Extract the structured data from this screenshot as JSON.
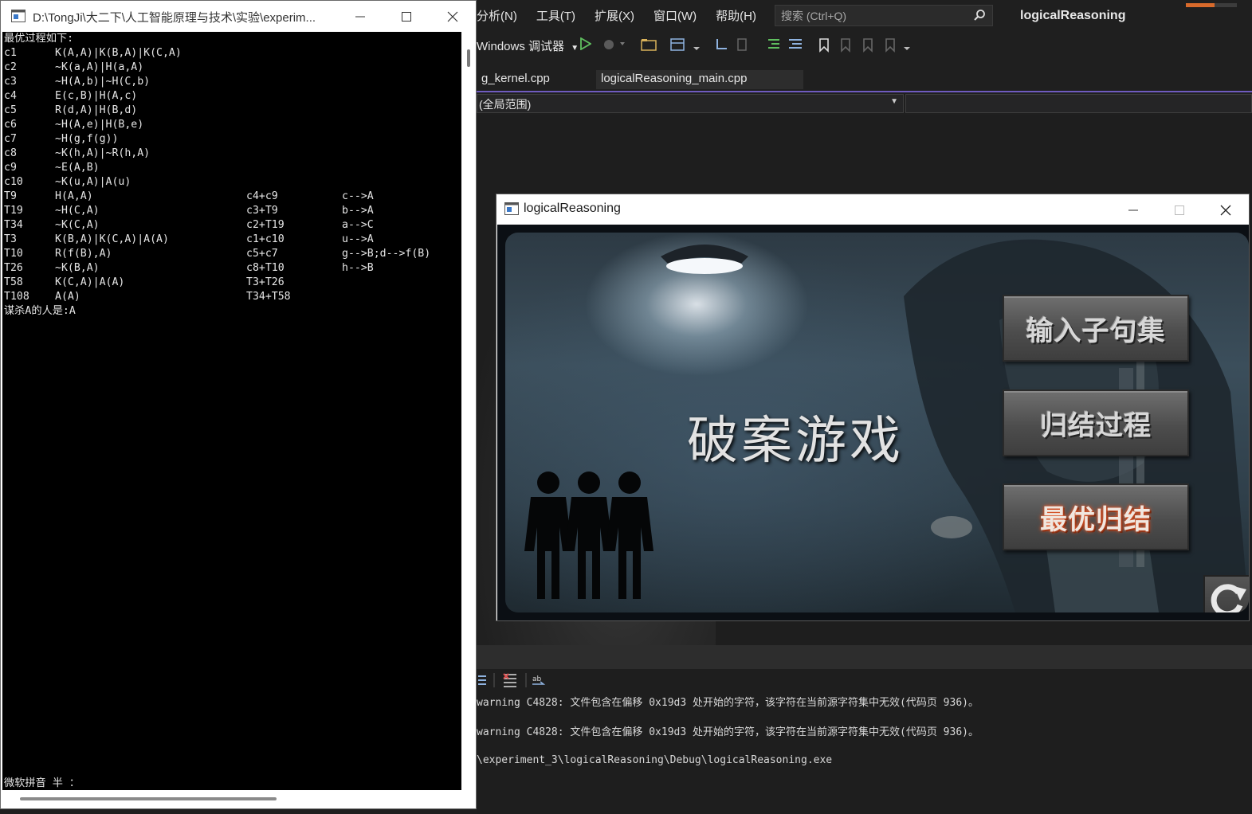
{
  "vs": {
    "menu": [
      "分析(N)",
      "工具(T)",
      "扩展(X)",
      "窗口(W)",
      "帮助(H)"
    ],
    "search_placeholder": "搜索 (Ctrl+Q)",
    "title": "logicalReasoning",
    "debugger_label": "Windows 调试器",
    "tabs": [
      "g_kernel.cpp",
      "logicalReasoning_main.cpp"
    ],
    "scope": "(全局范围)",
    "output_lines": [
      "warning C4828: 文件包含在偏移 0x19d3 处开始的字符，该字符在当前源字符集中无效(代码页 936)。",
      "warning C4828: 文件包含在偏移 0x19d3 处开始的字符，该字符在当前源字符集中无效(代码页 936)。",
      "\\experiment_3\\logicalReasoning\\Debug\\logicalReasoning.exe"
    ]
  },
  "console": {
    "title": "D:\\TongJi\\大二下\\人工智能原理与技术\\实验\\experim...",
    "header": "最优过程如下:",
    "clauses": [
      {
        "id": "c1",
        "expr": "K(A,A)|K(B,A)|K(C,A)"
      },
      {
        "id": "c2",
        "expr": "~K(a,A)|H(a,A)"
      },
      {
        "id": "c3",
        "expr": "~H(A,b)|~H(C,b)"
      },
      {
        "id": "c4",
        "expr": "E(c,B)|H(A,c)"
      },
      {
        "id": "c5",
        "expr": "R(d,A)|H(B,d)"
      },
      {
        "id": "c6",
        "expr": "~H(A,e)|H(B,e)"
      },
      {
        "id": "c7",
        "expr": "~H(g,f(g))"
      },
      {
        "id": "c8",
        "expr": "~K(h,A)|~R(h,A)"
      },
      {
        "id": "c9",
        "expr": "~E(A,B)"
      },
      {
        "id": "c10",
        "expr": "~K(u,A)|A(u)"
      }
    ],
    "steps": [
      {
        "id": "T9",
        "expr": "H(A,A)",
        "from": "c4+c9",
        "subst": "c-->A"
      },
      {
        "id": "T19",
        "expr": "~H(C,A)",
        "from": "c3+T9",
        "subst": "b-->A"
      },
      {
        "id": "T34",
        "expr": "~K(C,A)",
        "from": "c2+T19",
        "subst": "a-->C"
      },
      {
        "id": "T3",
        "expr": "K(B,A)|K(C,A)|A(A)",
        "from": "c1+c10",
        "subst": "u-->A"
      },
      {
        "id": "T10",
        "expr": "R(f(B),A)",
        "from": "c5+c7",
        "subst": "g-->B;d-->f(B)"
      },
      {
        "id": "T26",
        "expr": "~K(B,A)",
        "from": "c8+T10",
        "subst": "h-->B"
      },
      {
        "id": "T58",
        "expr": "K(C,A)|A(A)",
        "from": "T3+T26",
        "subst": ""
      },
      {
        "id": "T108",
        "expr": "A(A)",
        "from": "T34+T58",
        "subst": ""
      }
    ],
    "conclusion": "谋杀A的人是:A",
    "ime_status": "微软拼音 半 ："
  },
  "game": {
    "window_title": "logicalReasoning",
    "heading": "破案游戏",
    "buttons": {
      "input_clauses": "输入子句集",
      "resolution_process": "归结过程",
      "optimal_resolution": "最优归结"
    }
  },
  "colors": {
    "vs_bg": "#1f1f1f",
    "accent_orange": "#d86a2b",
    "tab_underline": "#6f5bbf",
    "console_bg": "#000000",
    "console_text": "#e6e6e6",
    "optimal_glow": "#e0572b"
  }
}
